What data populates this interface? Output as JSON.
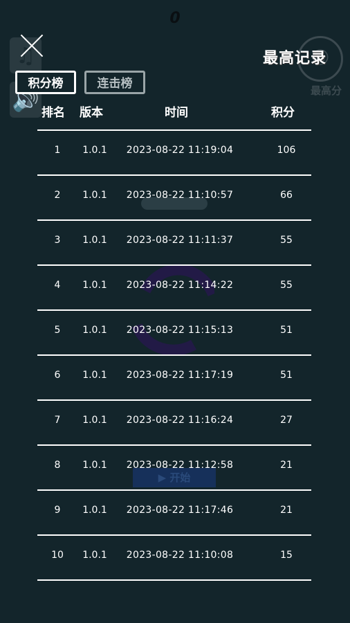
{
  "background": {
    "score": "0",
    "music_icon": "♫",
    "sound_icon": "🔊",
    "best_label": "最高分",
    "start_label": "▶ 开始"
  },
  "dialog": {
    "title": "最高记录",
    "tabs": [
      {
        "label": "积分榜",
        "active": true
      },
      {
        "label": "连击榜",
        "active": false
      }
    ],
    "columns": {
      "rank": "排名",
      "version": "版本",
      "time": "时间",
      "score": "积分"
    },
    "rows": [
      {
        "rank": "1",
        "version": "1.0.1",
        "time": "2023-08-22  11:19:04",
        "score": "106"
      },
      {
        "rank": "2",
        "version": "1.0.1",
        "time": "2023-08-22  11:10:57",
        "score": "66"
      },
      {
        "rank": "3",
        "version": "1.0.1",
        "time": "2023-08-22  11:11:37",
        "score": "55"
      },
      {
        "rank": "4",
        "version": "1.0.1",
        "time": "2023-08-22  11:14:22",
        "score": "55"
      },
      {
        "rank": "5",
        "version": "1.0.1",
        "time": "2023-08-22  11:15:13",
        "score": "51"
      },
      {
        "rank": "6",
        "version": "1.0.1",
        "time": "2023-08-22  11:17:19",
        "score": "51"
      },
      {
        "rank": "7",
        "version": "1.0.1",
        "time": "2023-08-22  11:16:24",
        "score": "27"
      },
      {
        "rank": "8",
        "version": "1.0.1",
        "time": "2023-08-22  11:12:58",
        "score": "21"
      },
      {
        "rank": "9",
        "version": "1.0.1",
        "time": "2023-08-22  11:17:46",
        "score": "21"
      },
      {
        "rank": "10",
        "version": "1.0.1",
        "time": "2023-08-22  11:10:08",
        "score": "15"
      }
    ]
  }
}
